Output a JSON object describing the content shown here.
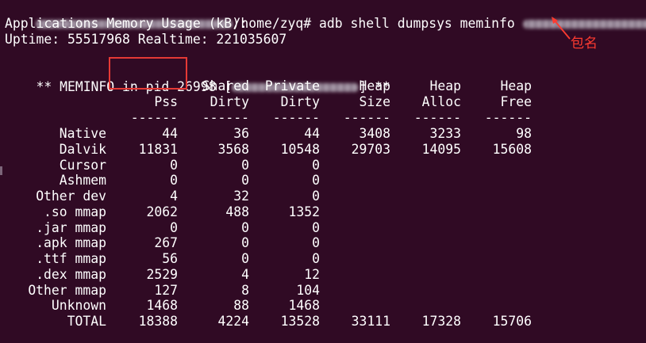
{
  "window": {
    "prompt_suffix": "/home/zyq# ",
    "command": "adb shell dumpsys meminfo"
  },
  "output": {
    "line1": "Applications Memory Usage (kB):",
    "line2": "Uptime: 55517968 Realtime: 221035607",
    "meminfo_prefix": "** MEMINFO in ",
    "pid_text": "pid 26998",
    "meminfo_open_bracket": " [",
    "meminfo_close": "] **"
  },
  "annotation": {
    "label": "包名",
    "color": "#ff3b30"
  },
  "table": {
    "header_top": [
      "",
      "Shared",
      "Private",
      "Heap",
      "Heap",
      "Heap"
    ],
    "header_bottom": [
      "Pss",
      "Dirty",
      "Dirty",
      "Size",
      "Alloc",
      "Free"
    ],
    "divider": [
      "------",
      "------",
      "------",
      "------",
      "------",
      "------"
    ],
    "rows": [
      {
        "label": "Native",
        "values": [
          "44",
          "36",
          "44",
          "3408",
          "3233",
          "98"
        ]
      },
      {
        "label": "Dalvik",
        "values": [
          "11831",
          "3568",
          "10548",
          "29703",
          "14095",
          "15608"
        ]
      },
      {
        "label": "Cursor",
        "values": [
          "0",
          "0",
          "0",
          "",
          "",
          ""
        ]
      },
      {
        "label": "Ashmem",
        "values": [
          "0",
          "0",
          "0",
          "",
          "",
          ""
        ]
      },
      {
        "label": "Other dev",
        "values": [
          "4",
          "32",
          "0",
          "",
          "",
          ""
        ]
      },
      {
        "label": ".so mmap",
        "values": [
          "2062",
          "488",
          "1352",
          "",
          "",
          ""
        ]
      },
      {
        "label": ".jar mmap",
        "values": [
          "0",
          "0",
          "0",
          "",
          "",
          ""
        ]
      },
      {
        "label": ".apk mmap",
        "values": [
          "267",
          "0",
          "0",
          "",
          "",
          ""
        ]
      },
      {
        "label": ".ttf mmap",
        "values": [
          "56",
          "0",
          "0",
          "",
          "",
          ""
        ]
      },
      {
        "label": ".dex mmap",
        "values": [
          "2529",
          "4",
          "12",
          "",
          "",
          ""
        ]
      },
      {
        "label": "Other mmap",
        "values": [
          "127",
          "8",
          "104",
          "",
          "",
          ""
        ]
      },
      {
        "label": "Unknown",
        "values": [
          "1468",
          "88",
          "1468",
          "",
          "",
          ""
        ]
      },
      {
        "label": "TOTAL",
        "values": [
          "18388",
          "4224",
          "13528",
          "33111",
          "17328",
          "15706"
        ]
      }
    ]
  },
  "colors": {
    "background": "#300a24",
    "text": "#ffffff",
    "highlight": "#e53935"
  }
}
